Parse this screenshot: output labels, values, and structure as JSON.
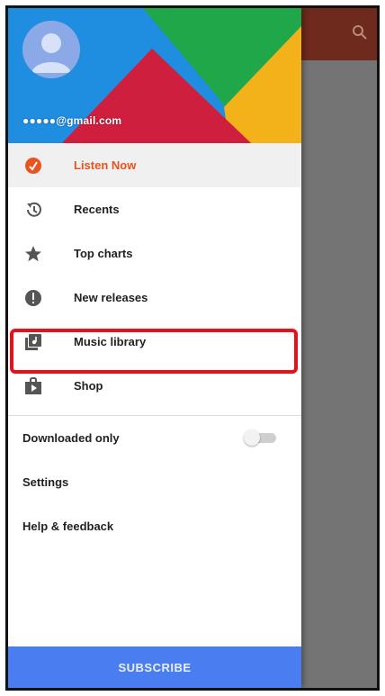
{
  "account": {
    "email": "●●●●●@gmail.com"
  },
  "menu": {
    "items": [
      {
        "label": "Listen Now",
        "icon": "listen-now-icon",
        "active": true
      },
      {
        "label": "Recents",
        "icon": "recents-icon"
      },
      {
        "label": "Top charts",
        "icon": "star-icon"
      },
      {
        "label": "New releases",
        "icon": "new-releases-icon"
      },
      {
        "label": "Music library",
        "icon": "music-library-icon",
        "highlighted": true
      },
      {
        "label": "Shop",
        "icon": "shop-icon"
      }
    ]
  },
  "settings": {
    "downloaded_only": {
      "label": "Downloaded only",
      "enabled": false
    },
    "settings_label": "Settings",
    "help_label": "Help & feedback"
  },
  "footer": {
    "subscribe_label": "SUBSCRIBE"
  },
  "colors": {
    "accent": "#e8531f",
    "subscribe": "#4a7ef0",
    "highlight": "#e8101a",
    "toolbar": "#6e2a1c"
  }
}
